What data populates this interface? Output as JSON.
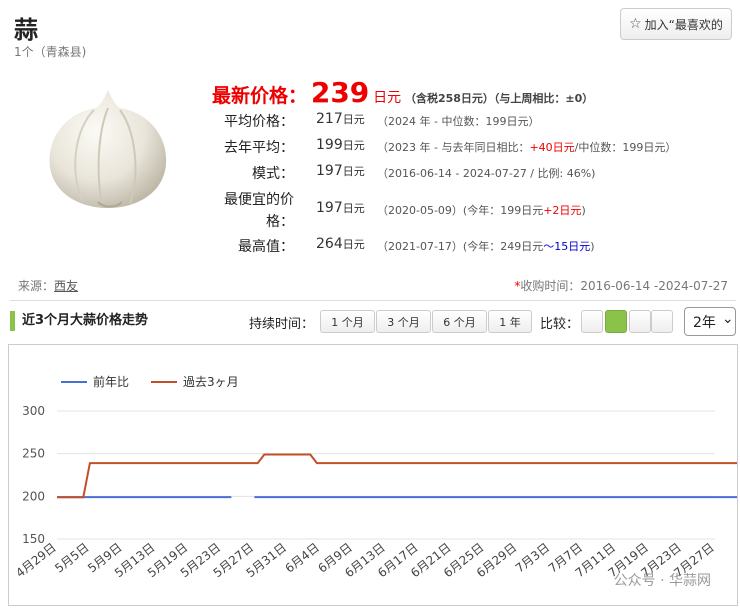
{
  "header": {
    "title": "蒜",
    "subtitle": "1个（青森县)",
    "fav_label": "加入“最喜欢的"
  },
  "latest": {
    "label": "最新价格：",
    "value": "239",
    "unit": "日元",
    "note": "（含税258日元）（与上周相比：±0）"
  },
  "stats": {
    "avg": {
      "label": "平均价格：",
      "value": "217",
      "unit": "日元",
      "detail": "（2024 年 - 中位数：199日元）"
    },
    "last_year": {
      "label": "去年平均：",
      "value": "199",
      "unit": "日元",
      "detail_a": "（2023 年 - 与去年同日相比：",
      "detail_red": "+40日元",
      "detail_b": "/中位数：199日元）"
    },
    "mode": {
      "label": "模式：",
      "value": "197",
      "unit": "日元",
      "detail": "（2016-06-14 - 2024-07-27 / 比例: 46%)"
    },
    "lowest": {
      "label_1": "最便宜的价",
      "label_2": "格：",
      "value": "197",
      "unit": "日元",
      "detail_a": "（2020-05-09）(今年：199日元",
      "detail_red": "+2日元",
      "detail_b": ")"
    },
    "highest": {
      "label": "最高值：",
      "value": "264",
      "unit": "日元",
      "detail_a": "（2021-07-17）(今年：249日元",
      "detail_blue": "～15日元",
      "detail_b": ")"
    }
  },
  "footer": {
    "source_label": "来源：",
    "source_link": "西友",
    "period_ast": "*",
    "period": "收购时间：2016-06-14 -2024-07-27"
  },
  "controls": {
    "section_title": "近3个月大蒜价格走势",
    "duration_label": "持续时间：",
    "durations": [
      "1 个月",
      "3 个月",
      "6 个月",
      "1 年"
    ],
    "compare_label": "比较：",
    "year_select": "2年",
    "chevron": "⌄"
  },
  "watermark": "公众号 · 华蒜网",
  "colors": {
    "accent_green": "#8bc34a",
    "red": "#e00000",
    "blue_series": "#4a6fd6",
    "orange_series": "#c0502a"
  },
  "chart_data": {
    "type": "line",
    "ylim": [
      150,
      300
    ],
    "yticks": [
      150,
      200,
      250,
      300
    ],
    "x_labels": [
      "4月29日",
      "5月5日",
      "5月9日",
      "5月13日",
      "5月19日",
      "5月23日",
      "5月27日",
      "5月31日",
      "6月4日",
      "6月9日",
      "6月13日",
      "6月17日",
      "6月21日",
      "6月25日",
      "6月29日",
      "7月3日",
      "7月7日",
      "7月11日",
      "7月19日",
      "7月23日",
      "7月27日"
    ],
    "series": [
      {
        "name": "前年比",
        "color": "#4a6fd6",
        "segments": [
          {
            "from": 0,
            "to": 5.3,
            "value": 199
          },
          {
            "from": 6.0,
            "to": 20.8,
            "value": 199
          }
        ]
      },
      {
        "name": "過去3ヶ月",
        "color": "#c0502a",
        "points": [
          [
            0,
            199
          ],
          [
            0.8,
            199
          ],
          [
            1,
            239
          ],
          [
            6.1,
            239
          ],
          [
            6.3,
            249
          ],
          [
            7.7,
            249
          ],
          [
            7.9,
            239
          ],
          [
            20.8,
            239
          ]
        ]
      }
    ],
    "legend_position": "top-left",
    "grid": true
  }
}
